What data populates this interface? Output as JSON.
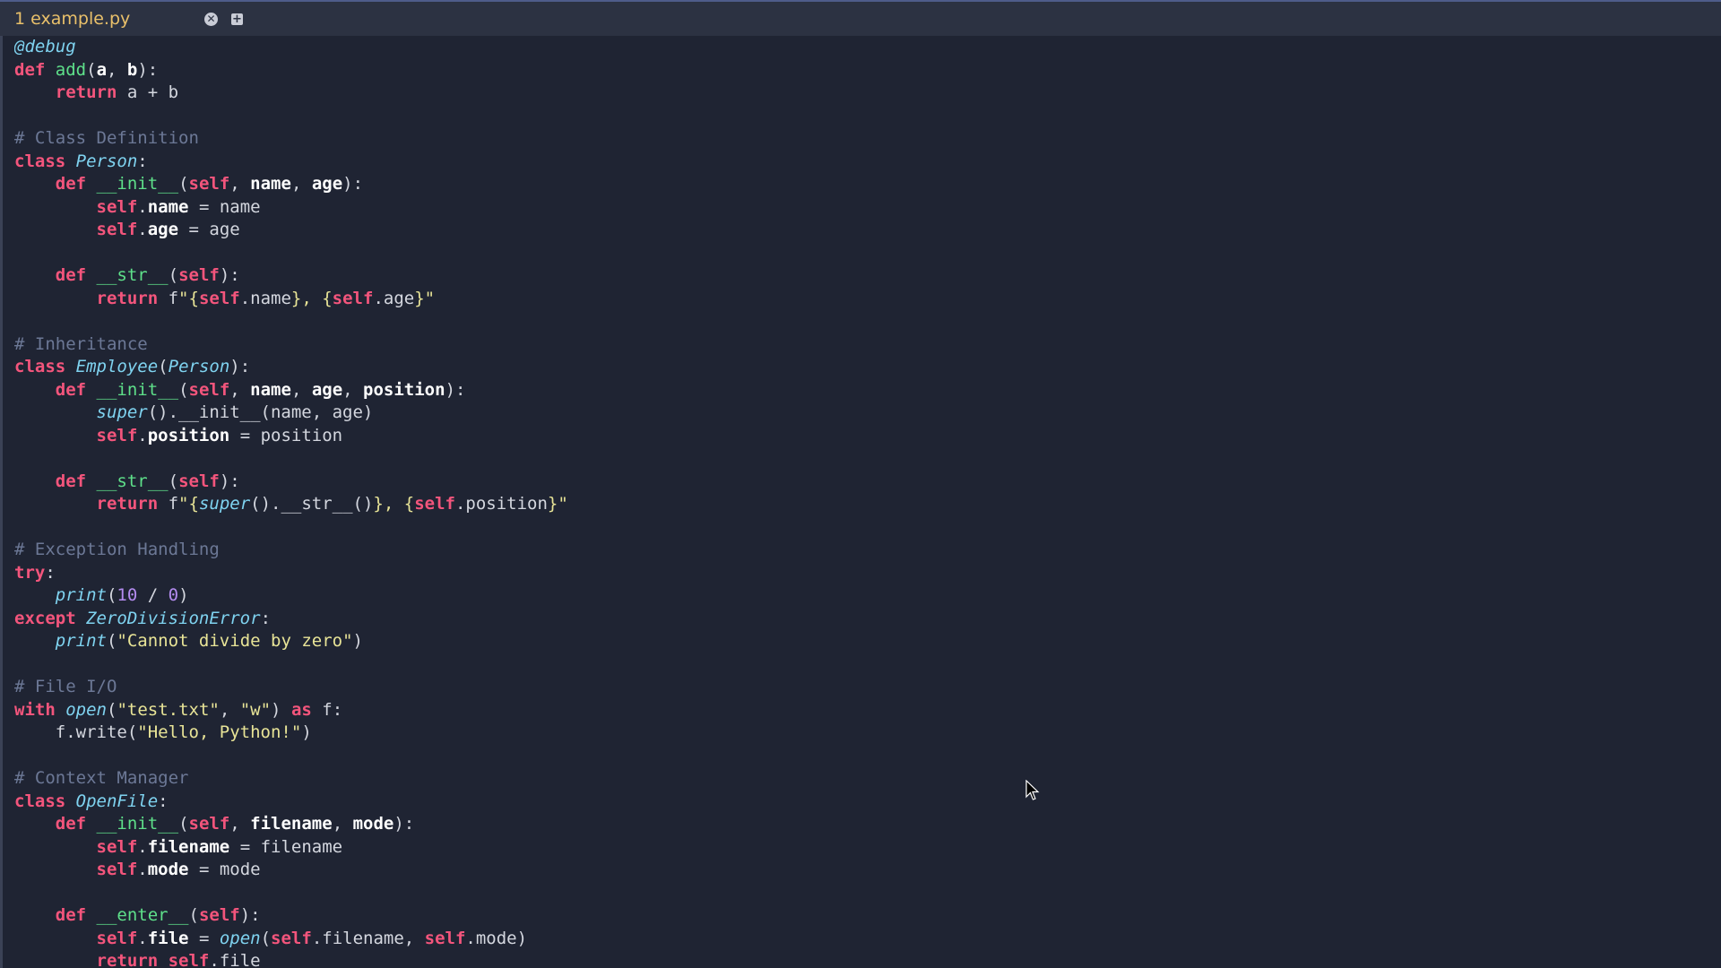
{
  "tab": {
    "label": "1 example.py",
    "close_glyph": "✕",
    "new_glyph": "+"
  },
  "icons": {
    "close": "close-icon",
    "new_tab": "plus-icon",
    "cursor": "mouse-pointer-icon"
  },
  "colors": {
    "background": "#1f2433",
    "keyword": "#f3557c",
    "function": "#5ee08a",
    "class": "#7fd3f0",
    "comment": "#6c7896",
    "string": "#e8e497",
    "number": "#b48cf0",
    "tab_label": "#e9c06a"
  },
  "code": [
    [
      [
        "dec",
        "@debug"
      ]
    ],
    [
      [
        "kw",
        "def"
      ],
      [
        "p",
        " "
      ],
      [
        "fn",
        "add"
      ],
      [
        "p",
        "("
      ],
      [
        "bold",
        "a"
      ],
      [
        "p",
        ", "
      ],
      [
        "bold",
        "b"
      ],
      [
        "p",
        "):"
      ]
    ],
    [
      [
        "p",
        "    "
      ],
      [
        "kw",
        "return"
      ],
      [
        "p",
        " a + b"
      ]
    ],
    [],
    [
      [
        "cm",
        "# Class Definition"
      ]
    ],
    [
      [
        "kw",
        "class"
      ],
      [
        "p",
        " "
      ],
      [
        "cls",
        "Person"
      ],
      [
        "p",
        ":"
      ]
    ],
    [
      [
        "p",
        "    "
      ],
      [
        "kw",
        "def"
      ],
      [
        "p",
        " "
      ],
      [
        "fn",
        "__init__"
      ],
      [
        "p",
        "("
      ],
      [
        "kw",
        "self"
      ],
      [
        "p",
        ", "
      ],
      [
        "bold",
        "name"
      ],
      [
        "p",
        ", "
      ],
      [
        "bold",
        "age"
      ],
      [
        "p",
        "):"
      ]
    ],
    [
      [
        "p",
        "        "
      ],
      [
        "kw",
        "self"
      ],
      [
        "p",
        "."
      ],
      [
        "bold",
        "name"
      ],
      [
        "p",
        " = name"
      ]
    ],
    [
      [
        "p",
        "        "
      ],
      [
        "kw",
        "self"
      ],
      [
        "p",
        "."
      ],
      [
        "bold",
        "age"
      ],
      [
        "p",
        " = age"
      ]
    ],
    [],
    [
      [
        "p",
        "    "
      ],
      [
        "kw",
        "def"
      ],
      [
        "p",
        " "
      ],
      [
        "fn",
        "__str__"
      ],
      [
        "p",
        "("
      ],
      [
        "kw",
        "self"
      ],
      [
        "p",
        "):"
      ]
    ],
    [
      [
        "p",
        "        "
      ],
      [
        "kw",
        "return"
      ],
      [
        "p",
        " f"
      ],
      [
        "str",
        "\"{"
      ],
      [
        "kw",
        "self"
      ],
      [
        "p",
        ".name"
      ],
      [
        "str",
        "}, {"
      ],
      [
        "kw",
        "self"
      ],
      [
        "p",
        ".age"
      ],
      [
        "str",
        "}\""
      ]
    ],
    [],
    [
      [
        "cm",
        "# Inheritance"
      ]
    ],
    [
      [
        "kw",
        "class"
      ],
      [
        "p",
        " "
      ],
      [
        "cls",
        "Employee"
      ],
      [
        "p",
        "("
      ],
      [
        "cls",
        "Person"
      ],
      [
        "p",
        "):"
      ]
    ],
    [
      [
        "p",
        "    "
      ],
      [
        "kw",
        "def"
      ],
      [
        "p",
        " "
      ],
      [
        "fn",
        "__init__"
      ],
      [
        "p",
        "("
      ],
      [
        "kw",
        "self"
      ],
      [
        "p",
        ", "
      ],
      [
        "bold",
        "name"
      ],
      [
        "p",
        ", "
      ],
      [
        "bold",
        "age"
      ],
      [
        "p",
        ", "
      ],
      [
        "bold",
        "position"
      ],
      [
        "p",
        "):"
      ]
    ],
    [
      [
        "p",
        "        "
      ],
      [
        "cls",
        "super"
      ],
      [
        "p",
        "().__init__(name, age)"
      ]
    ],
    [
      [
        "p",
        "        "
      ],
      [
        "kw",
        "self"
      ],
      [
        "p",
        "."
      ],
      [
        "bold",
        "position"
      ],
      [
        "p",
        " = position"
      ]
    ],
    [],
    [
      [
        "p",
        "    "
      ],
      [
        "kw",
        "def"
      ],
      [
        "p",
        " "
      ],
      [
        "fn",
        "__str__"
      ],
      [
        "p",
        "("
      ],
      [
        "kw",
        "self"
      ],
      [
        "p",
        "):"
      ]
    ],
    [
      [
        "p",
        "        "
      ],
      [
        "kw",
        "return"
      ],
      [
        "p",
        " f"
      ],
      [
        "str",
        "\"{"
      ],
      [
        "cls",
        "super"
      ],
      [
        "p",
        "().__str__()"
      ],
      [
        "str",
        "}, {"
      ],
      [
        "kw",
        "self"
      ],
      [
        "p",
        ".position"
      ],
      [
        "str",
        "}\""
      ]
    ],
    [],
    [
      [
        "cm",
        "# Exception Handling"
      ]
    ],
    [
      [
        "kw",
        "try"
      ],
      [
        "p",
        ":"
      ]
    ],
    [
      [
        "p",
        "    "
      ],
      [
        "cls",
        "print"
      ],
      [
        "p",
        "("
      ],
      [
        "num",
        "10"
      ],
      [
        "p",
        " / "
      ],
      [
        "num",
        "0"
      ],
      [
        "p",
        ")"
      ]
    ],
    [
      [
        "kw",
        "except"
      ],
      [
        "p",
        " "
      ],
      [
        "cls",
        "ZeroDivisionError"
      ],
      [
        "p",
        ":"
      ]
    ],
    [
      [
        "p",
        "    "
      ],
      [
        "cls",
        "print"
      ],
      [
        "p",
        "("
      ],
      [
        "str",
        "\"Cannot divide by zero\""
      ],
      [
        "p",
        ")"
      ]
    ],
    [],
    [
      [
        "cm",
        "# File I/O"
      ]
    ],
    [
      [
        "kw",
        "with"
      ],
      [
        "p",
        " "
      ],
      [
        "cls",
        "open"
      ],
      [
        "p",
        "("
      ],
      [
        "str",
        "\"test.txt\""
      ],
      [
        "p",
        ", "
      ],
      [
        "str",
        "\"w\""
      ],
      [
        "p",
        ") "
      ],
      [
        "kw",
        "as"
      ],
      [
        "p",
        " f:"
      ]
    ],
    [
      [
        "p",
        "    f.write("
      ],
      [
        "str",
        "\"Hello, Python!\""
      ],
      [
        "p",
        ")"
      ]
    ],
    [],
    [
      [
        "cm",
        "# Context Manager"
      ]
    ],
    [
      [
        "kw",
        "class"
      ],
      [
        "p",
        " "
      ],
      [
        "cls",
        "OpenFile"
      ],
      [
        "p",
        ":"
      ]
    ],
    [
      [
        "p",
        "    "
      ],
      [
        "kw",
        "def"
      ],
      [
        "p",
        " "
      ],
      [
        "fn",
        "__init__"
      ],
      [
        "p",
        "("
      ],
      [
        "kw",
        "self"
      ],
      [
        "p",
        ", "
      ],
      [
        "bold",
        "filename"
      ],
      [
        "p",
        ", "
      ],
      [
        "bold",
        "mode"
      ],
      [
        "p",
        "):"
      ]
    ],
    [
      [
        "p",
        "        "
      ],
      [
        "kw",
        "self"
      ],
      [
        "p",
        "."
      ],
      [
        "bold",
        "filename"
      ],
      [
        "p",
        " = filename"
      ]
    ],
    [
      [
        "p",
        "        "
      ],
      [
        "kw",
        "self"
      ],
      [
        "p",
        "."
      ],
      [
        "bold",
        "mode"
      ],
      [
        "p",
        " = mode"
      ]
    ],
    [],
    [
      [
        "p",
        "    "
      ],
      [
        "kw",
        "def"
      ],
      [
        "p",
        " "
      ],
      [
        "fn",
        "__enter__"
      ],
      [
        "p",
        "("
      ],
      [
        "kw",
        "self"
      ],
      [
        "p",
        "):"
      ]
    ],
    [
      [
        "p",
        "        "
      ],
      [
        "kw",
        "self"
      ],
      [
        "p",
        "."
      ],
      [
        "bold",
        "file"
      ],
      [
        "p",
        " = "
      ],
      [
        "cls",
        "open"
      ],
      [
        "p",
        "("
      ],
      [
        "kw",
        "self"
      ],
      [
        "p",
        ".filename, "
      ],
      [
        "kw",
        "self"
      ],
      [
        "p",
        ".mode)"
      ]
    ],
    [
      [
        "p",
        "        "
      ],
      [
        "kw",
        "return"
      ],
      [
        "p",
        " "
      ],
      [
        "kw",
        "self"
      ],
      [
        "p",
        ".file"
      ]
    ]
  ]
}
